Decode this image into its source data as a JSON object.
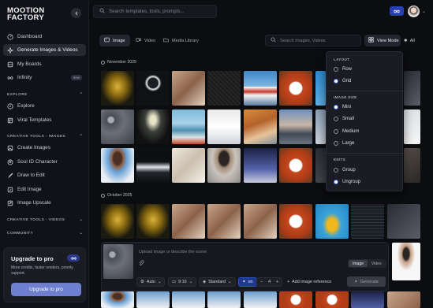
{
  "brand": {
    "line1": "MOOTION",
    "line2": "FACTORY"
  },
  "sidebar": {
    "items": [
      {
        "label": "Dashboard"
      },
      {
        "label": "Generate Images & Videos"
      },
      {
        "label": "My Boards"
      },
      {
        "label": "Infinity",
        "tag": "new"
      }
    ],
    "explore_title": "EXPLORE",
    "explore": [
      {
        "label": "Explore"
      },
      {
        "label": "Viral Templates"
      }
    ],
    "creative_images_title": "CREATIVE TOOLS - IMAGES",
    "creative_images": [
      {
        "label": "Create Images"
      },
      {
        "label": "Soul ID Character"
      },
      {
        "label": "Draw to Edit"
      },
      {
        "label": "Edit Image"
      },
      {
        "label": "Image Upscale"
      }
    ],
    "creative_videos_title": "CREATIVE TOOLS - VIDEOS",
    "community_title": "COMMUNITY",
    "upgrade": {
      "title": "Upgrade to pro",
      "desc": "More credits, faster renders, priority support.",
      "button": "Upgrade to pro"
    }
  },
  "top": {
    "search_placeholder": "Search templates, tools, prompts..."
  },
  "toolbar": {
    "tabs": [
      {
        "label": "Image"
      },
      {
        "label": "Video"
      },
      {
        "label": "Media Library"
      }
    ],
    "search_placeholder": "Search Images, Videos",
    "view_mode": "View Mode",
    "all": "All"
  },
  "groups": [
    {
      "date": "November 2025"
    },
    {
      "date": "October 2025"
    }
  ],
  "view_menu": {
    "layout_title": "LAYOUT",
    "layout": [
      {
        "label": "Row",
        "selected": false
      },
      {
        "label": "Grid",
        "selected": true
      }
    ],
    "size_title": "IMAGE SIZE",
    "size": [
      {
        "label": "Mini",
        "selected": true
      },
      {
        "label": "Small",
        "selected": false
      },
      {
        "label": "Medium",
        "selected": false
      },
      {
        "label": "Large",
        "selected": false
      }
    ],
    "edits_title": "EDITS",
    "edits": [
      {
        "label": "Group",
        "selected": false
      },
      {
        "label": "Ungroup",
        "selected": true
      }
    ]
  },
  "prompt": {
    "placeholder": "Upload image or describe the scene",
    "mode": [
      {
        "label": "Image",
        "on": true
      },
      {
        "label": "Video",
        "on": false
      }
    ],
    "controls": {
      "model": "Auto",
      "ratio": "9:16",
      "quality": "Standard",
      "toggle": "on",
      "count": "4",
      "add_ref": "Add image reference",
      "generate": "Generate"
    }
  },
  "colors": {
    "accent": "#3e63ee",
    "upgrade_button": "#6e7fcf",
    "infinity_badge": "#2a3fb3"
  }
}
